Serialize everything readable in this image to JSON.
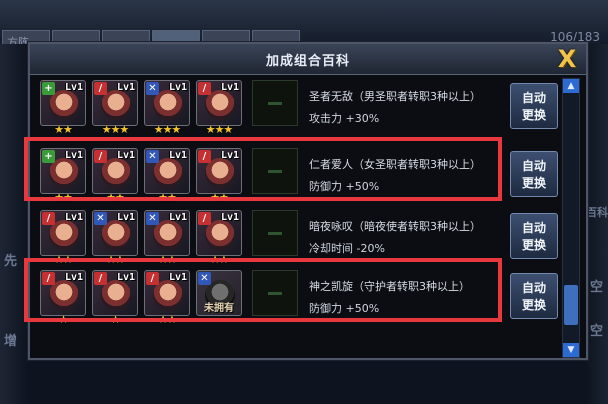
{
  "background": {
    "counter": "106/183",
    "tabs": [
      "方阵",
      "",
      "",
      "",
      "",
      ""
    ],
    "side_left": [
      "先",
      "增"
    ],
    "side_right": [
      "百科",
      "空",
      "空"
    ]
  },
  "modal": {
    "title": "加成组合百科",
    "close_label": "X",
    "auto_replace_label_1": "自动",
    "auto_replace_label_2": "更换"
  },
  "rows": [
    {
      "title": "圣者无敌（男圣职者转职3种以上）",
      "bonus": "攻击力 +30%",
      "cards": [
        {
          "level": "Lv1",
          "job_icon": "cross-icon",
          "job_color": "green",
          "stars": "★★",
          "owned": true
        },
        {
          "level": "Lv1",
          "job_icon": "sword-icon",
          "job_color": "red",
          "stars": "★★★",
          "owned": true
        },
        {
          "level": "Lv1",
          "job_icon": "x-icon",
          "job_color": "blue",
          "stars": "★★★",
          "owned": true
        },
        {
          "level": "Lv1",
          "job_icon": "sword-icon",
          "job_color": "red",
          "stars": "★★★",
          "owned": true
        }
      ]
    },
    {
      "title": "仁者爱人（女圣职者转职3种以上）",
      "bonus": "防御力 +50%",
      "cards": [
        {
          "level": "Lv1",
          "job_icon": "cross-icon",
          "job_color": "green",
          "stars": "★★",
          "owned": true
        },
        {
          "level": "Lv1",
          "job_icon": "sword-icon",
          "job_color": "red",
          "stars": "★★",
          "owned": true
        },
        {
          "level": "Lv1",
          "job_icon": "x-icon",
          "job_color": "blue",
          "stars": "★★",
          "owned": true
        },
        {
          "level": "Lv1",
          "job_icon": "sword-icon",
          "job_color": "red",
          "stars": "★★",
          "owned": true
        }
      ]
    },
    {
      "title": "暗夜咏叹（暗夜使者转职3种以上）",
      "bonus": "冷却时间 -20%",
      "cards": [
        {
          "level": "Lv1",
          "job_icon": "sword-icon",
          "job_color": "red",
          "stars": "★★",
          "owned": true
        },
        {
          "level": "Lv1",
          "job_icon": "x-icon",
          "job_color": "blue",
          "stars": "★★",
          "owned": true
        },
        {
          "level": "Lv1",
          "job_icon": "x-icon",
          "job_color": "blue",
          "stars": "★★",
          "owned": true
        },
        {
          "level": "Lv1",
          "job_icon": "sword-icon",
          "job_color": "red",
          "stars": "★★",
          "owned": true
        }
      ]
    },
    {
      "title": "神之凯旋（守护者转职3种以上）",
      "bonus": "防御力 +50%",
      "cards": [
        {
          "level": "Lv1",
          "job_icon": "sword-icon",
          "job_color": "red",
          "stars": "★",
          "owned": true
        },
        {
          "level": "Lv1",
          "job_icon": "sword-icon",
          "job_color": "red",
          "stars": "★",
          "owned": true
        },
        {
          "level": "Lv1",
          "job_icon": "sword-icon",
          "job_color": "red",
          "stars": "★★",
          "owned": true
        },
        {
          "level": "",
          "job_icon": "x-icon",
          "job_color": "blue",
          "stars": "",
          "owned": false,
          "unowned_label": "未拥有"
        }
      ]
    }
  ]
}
